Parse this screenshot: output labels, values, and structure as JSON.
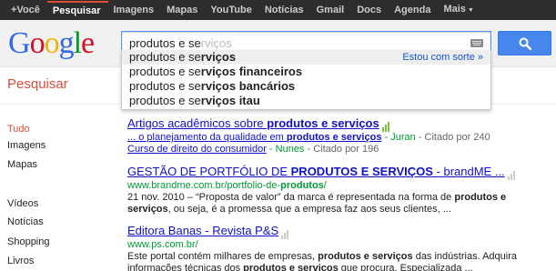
{
  "topbar": {
    "items": [
      "+Você",
      "Pesquisar",
      "Imagens",
      "Mapas",
      "YouTube",
      "Notícias",
      "Gmail",
      "Docs",
      "Agenda",
      "Mais"
    ],
    "active": "Pesquisar"
  },
  "logo": {
    "letters": [
      "G",
      "o",
      "o",
      "g",
      "l",
      "e"
    ]
  },
  "search": {
    "typed": "produtos e se",
    "completion": "rviços",
    "button_icon": "search-icon",
    "keyboard_icon": "keyboard-icon"
  },
  "suggestions": {
    "feeling_lucky": "Estou com sorte »",
    "items": [
      {
        "prefix": "produtos e se",
        "rest": "rviços"
      },
      {
        "prefix": "produtos e se",
        "rest": "rviços financeiros"
      },
      {
        "prefix": "produtos e se",
        "rest": "rviços bancários"
      },
      {
        "prefix": "produtos e se",
        "rest": "rviços itau"
      }
    ]
  },
  "left": {
    "heading": "Pesquisar",
    "items": [
      "Tudo",
      "Imagens",
      "Mapas",
      "Vídeos",
      "Notícias",
      "Shopping",
      "Livros"
    ],
    "active": "Tudo"
  },
  "results": [
    {
      "title_pre": "Artigos acadêmicos sobre ",
      "title_bold": "produtos e serviços",
      "sub1_link_pre": "... o planejamento da qualidade em ",
      "sub1_link_bold": "produtos e serviços",
      "sub1_source": " - Juran",
      "sub1_cited": " - Citado por 240",
      "sub2_link": "Curso de direito do consumidor",
      "sub2_source": " - Nunes",
      "sub2_cited": " - Citado por 196"
    },
    {
      "title_pre": "GESTÃO DE PORTFÓLIO DE ",
      "title_bold": "PRODUTOS E SERVIÇOS",
      "title_post": " - brandME ...",
      "url_pre": "www.brandme.com.br/portfolio-de-",
      "url_bold": "produtos",
      "url_post": "/",
      "snip1_pre": "21 nov. 2010 – “Proposta de valor” da marca é representada na forma de ",
      "snip1_bold": "produtos e",
      "snip2_bold": "serviços",
      "snip2_post": ", ou seja, é a promessa que a empresa faz aos seus clientes, ..."
    },
    {
      "title": "Editora Banas - Revista P&S",
      "url": "www.ps.com.br/",
      "snip1_pre": "Este portal contém milhares de empresas, ",
      "snip1_bold": "produtos e serviços",
      "snip1_post": " das indústrias. Adquira",
      "snip2_pre": "informações técnicas dos ",
      "snip2_bold": "produtos e serviços",
      "snip2_post": " que procura. Especializada ..."
    }
  ],
  "colors": {
    "topbar_bg": "#2d2d2d",
    "accent_red": "#dd4b39",
    "link_blue": "#1111cc",
    "url_green": "#009933",
    "search_button": "#4787ed"
  }
}
